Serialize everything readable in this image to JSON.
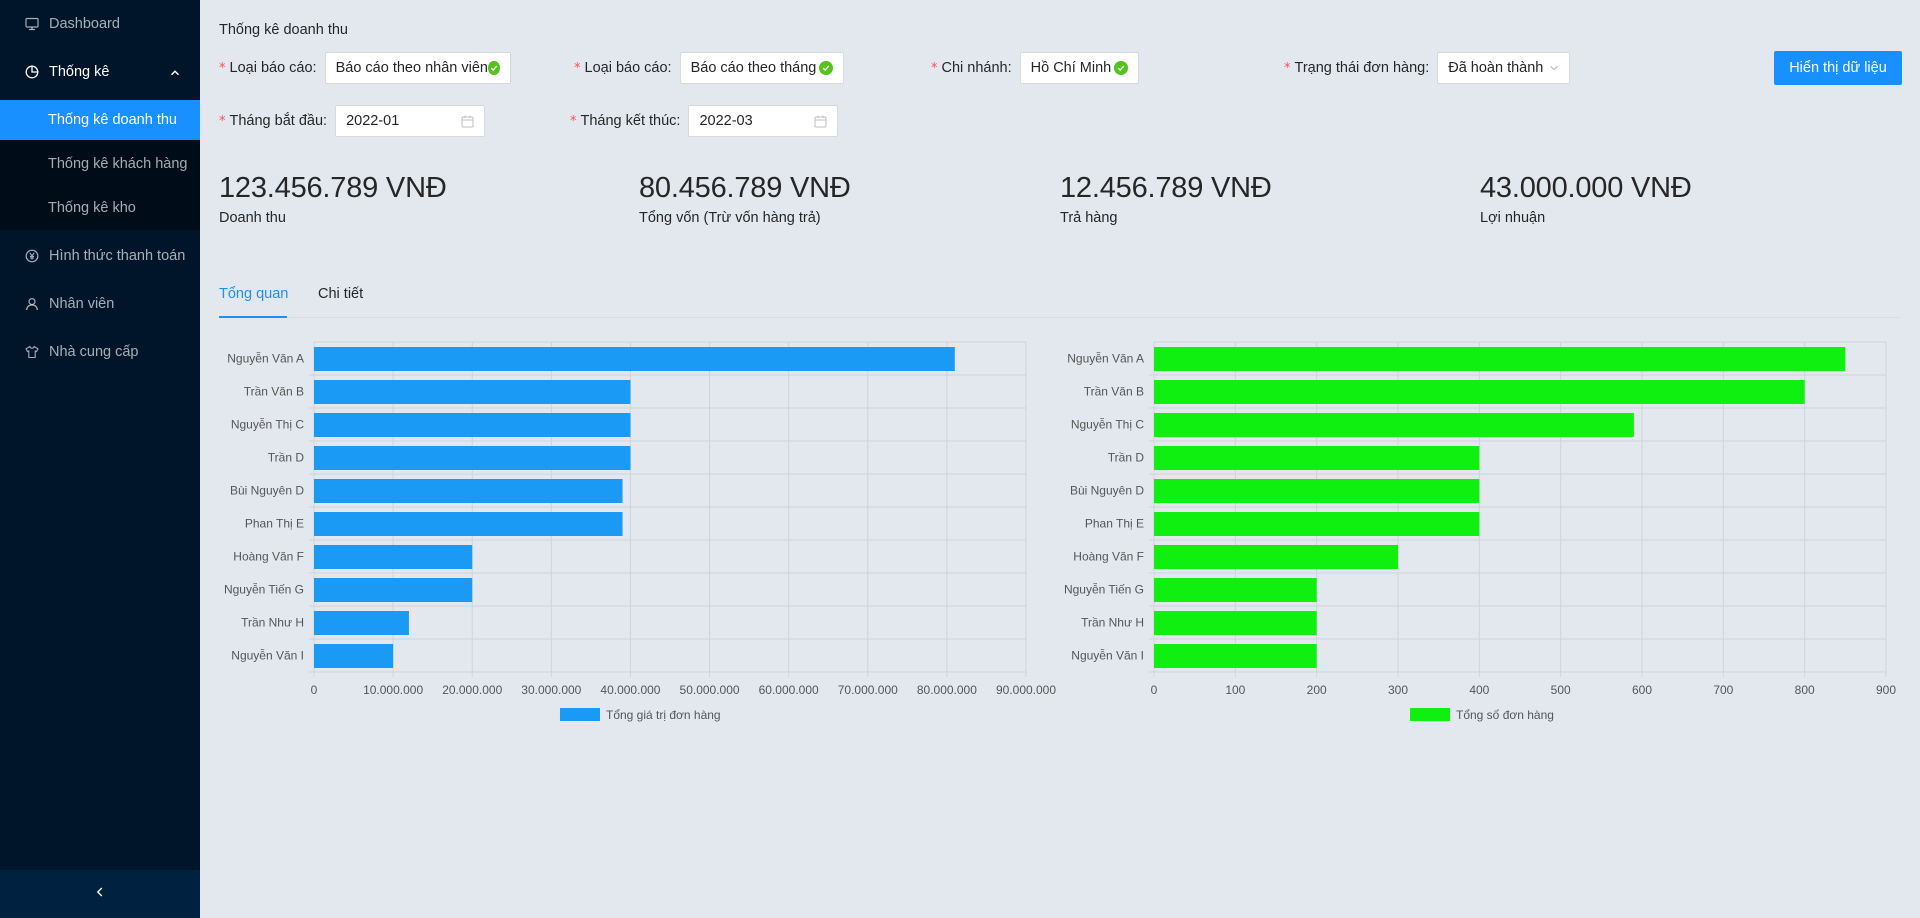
{
  "sidebar": {
    "items": [
      {
        "label": "Dashboard",
        "icon": "monitor-icon"
      },
      {
        "label": "Thống kê",
        "icon": "pie-chart-icon"
      },
      {
        "label": "Hình thức thanh toán",
        "icon": "yen-circle-icon"
      },
      {
        "label": "Nhân viên",
        "icon": "user-icon"
      },
      {
        "label": "Nhà cung cấp",
        "icon": "shirt-icon"
      }
    ],
    "submenu": [
      {
        "label": "Thống kê doanh thu",
        "active": true
      },
      {
        "label": "Thống kê khách hàng",
        "active": false
      },
      {
        "label": "Thống kê kho",
        "active": false
      }
    ]
  },
  "page": {
    "title": "Thống kê doanh thu"
  },
  "filters": {
    "report_type_1": {
      "label": "Loại báo cáo:",
      "value": "Báo cáo theo nhân viên"
    },
    "report_type_2": {
      "label": "Loại báo cáo:",
      "value": "Báo cáo theo tháng"
    },
    "branch": {
      "label": "Chi nhánh:",
      "value": "Hồ Chí Minh"
    },
    "order_status": {
      "label": "Trạng thái đơn hàng:",
      "value": "Đã hoàn thành"
    },
    "start_month": {
      "label": "Tháng bắt đầu:",
      "value": "2022-01"
    },
    "end_month": {
      "label": "Tháng kết thúc:",
      "value": "2022-03"
    },
    "submit_label": "Hiển thị dữ liệu"
  },
  "stats": [
    {
      "value": "123.456.789 VNĐ",
      "label": "Doanh thu"
    },
    {
      "value": "80.456.789 VNĐ",
      "label": "Tổng vốn (Trừ vốn hàng trả)"
    },
    {
      "value": "12.456.789 VNĐ",
      "label": "Trả hàng"
    },
    {
      "value": "43.000.000 VNĐ",
      "label": "Lợi nhuận"
    }
  ],
  "tabs": [
    {
      "label": "Tổng quan",
      "active": true
    },
    {
      "label": "Chi tiết",
      "active": false
    }
  ],
  "colors": {
    "primary": "#1890ff",
    "success": "#52c41a",
    "bar_blue": "#1a9af5",
    "bar_green": "#10f010",
    "sidebar_bg": "#001529"
  },
  "chart_data": [
    {
      "type": "bar",
      "orientation": "horizontal",
      "categories": [
        "Nguyễn Văn A",
        "Trần Văn B",
        "Nguyễn Thị C",
        "Trần D",
        "Bùi Nguyên D",
        "Phan Thị E",
        "Hoàng Văn F",
        "Nguyễn Tiến G",
        "Trần Như H",
        "Nguyễn Văn I"
      ],
      "series": [
        {
          "name": "Tổng giá trị đơn hàng",
          "values": [
            81000000,
            40000000,
            40000000,
            40000000,
            39000000,
            39000000,
            20000000,
            20000000,
            12000000,
            10000000
          ],
          "color": "#1a9af5"
        }
      ],
      "xlim": [
        0,
        90000000
      ],
      "xticks": [
        "0",
        "10.000.000",
        "20.000.000",
        "30.000.000",
        "40.000.000",
        "50.000.000",
        "60.000.000",
        "70.000.000",
        "80.000.000",
        "90.000.000"
      ],
      "grid": true,
      "legend_position": "bottom"
    },
    {
      "type": "bar",
      "orientation": "horizontal",
      "categories": [
        "Nguyễn Văn A",
        "Trần Văn B",
        "Nguyễn Thị C",
        "Trần D",
        "Bùi Nguyên D",
        "Phan Thị E",
        "Hoàng Văn F",
        "Nguyễn Tiến G",
        "Trần Như H",
        "Nguyễn Văn I"
      ],
      "series": [
        {
          "name": "Tổng số đơn hàng",
          "values": [
            850,
            800,
            590,
            400,
            400,
            400,
            300,
            200,
            200,
            200
          ],
          "color": "#10f010"
        }
      ],
      "xlim": [
        0,
        900
      ],
      "xticks": [
        "0",
        "100",
        "200",
        "300",
        "400",
        "500",
        "600",
        "700",
        "800",
        "900"
      ],
      "grid": true,
      "legend_position": "bottom"
    }
  ]
}
